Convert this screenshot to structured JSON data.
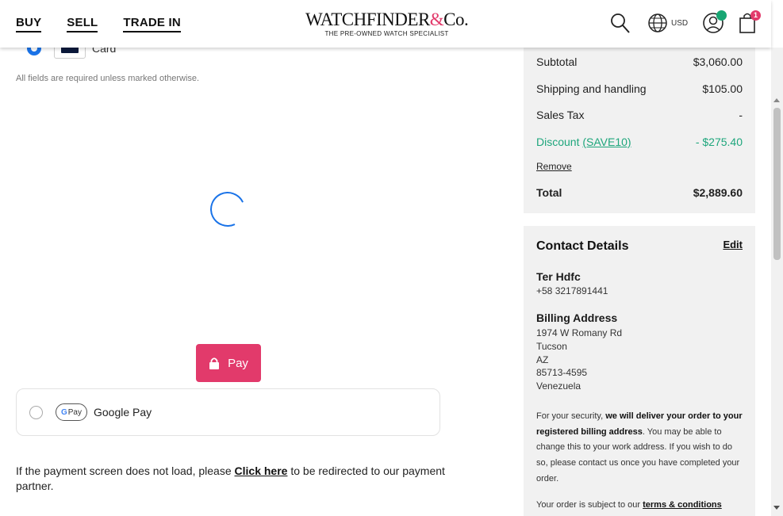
{
  "header": {
    "nav": [
      {
        "label": "BUY"
      },
      {
        "label": "SELL"
      },
      {
        "label": "TRADE IN"
      }
    ],
    "logo": {
      "part1": "WATCHFINDER",
      "amp": "&",
      "part2": "Co.",
      "tagline": "THE PRE-OWNED WATCH SPECIALIST"
    },
    "currency": "USD",
    "cart_count": "1",
    "icons": [
      "search-icon",
      "globe-icon",
      "account-icon",
      "bag-icon"
    ]
  },
  "payment": {
    "card_label": "Card",
    "required_note": "All fields are required unless marked otherwise.",
    "pay_label": "Pay",
    "gpay_logo_g": "G",
    "gpay_logo_text": "Pay",
    "gpay_label": "Google Pay",
    "redirect_before": "If the payment screen does not load, please ",
    "redirect_link": "Click here",
    "redirect_after": " to be redirected to our payment partner."
  },
  "summary": {
    "subtotal_label": "Subtotal",
    "subtotal_value": "$3,060.00",
    "shipping_label": "Shipping and handling",
    "shipping_value": "$105.00",
    "tax_label": "Sales Tax",
    "tax_value": "-",
    "discount_label": "Discount",
    "discount_code": "(SAVE10)",
    "discount_value": "- $275.40",
    "remove_label": "Remove",
    "total_label": "Total",
    "total_value": "$2,889.60"
  },
  "contact": {
    "title": "Contact Details",
    "edit_label": "Edit",
    "name": "Ter Hdfc",
    "phone": "+58 3217891441",
    "billing_title": "Billing Address",
    "address": [
      "1974 W Romany Rd",
      "Tucson",
      "AZ",
      "85713-4595",
      "Venezuela"
    ],
    "security_pre": "For your security, ",
    "security_bold": "we will deliver your order to your registered billing address",
    "security_post": ". You may be able to change this to your work address. If you wish to do so, please contact us once you have completed your order.",
    "terms_pre": "Your order is subject to our ",
    "terms_link": "terms & conditions"
  },
  "colors": {
    "accent": "#e23a6b",
    "discount": "#1ea67c",
    "radio": "#1a73e8",
    "panel_bg": "#f1f1f1"
  }
}
